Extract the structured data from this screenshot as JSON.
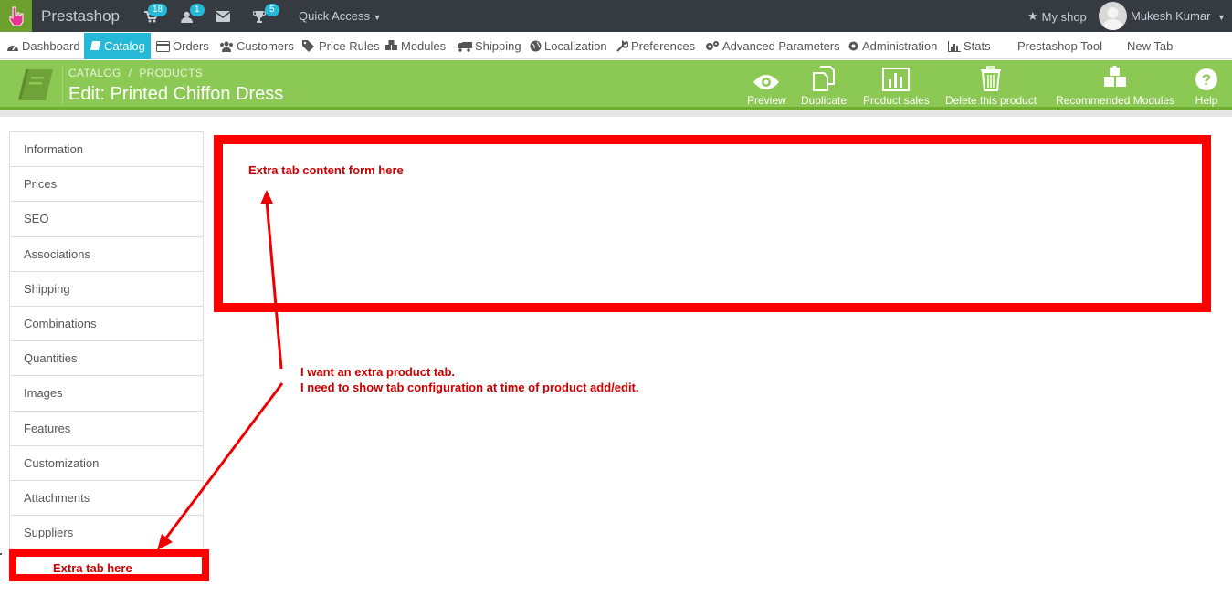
{
  "topbar": {
    "shop_name": "Prestashop",
    "cart_badge": "18",
    "customers_badge": "1",
    "trophy_badge": "5",
    "quick_access": "Quick Access",
    "my_shop": "My shop",
    "user_name": "Mukesh Kumar"
  },
  "nav": {
    "items": [
      {
        "label": "Dashboard",
        "icon": "dashboard-icon"
      },
      {
        "label": "Catalog",
        "icon": "book-icon",
        "active": true
      },
      {
        "label": "Orders",
        "icon": "credit-card-icon"
      },
      {
        "label": "Customers",
        "icon": "group-icon"
      },
      {
        "label": "Price Rules",
        "icon": "tags-icon"
      },
      {
        "label": "Modules",
        "icon": "puzzle-icon"
      },
      {
        "label": "Shipping",
        "icon": "truck-icon"
      },
      {
        "label": "Localization",
        "icon": "globe-icon"
      },
      {
        "label": "Preferences",
        "icon": "wrench-icon"
      },
      {
        "label": "Advanced Parameters",
        "icon": "cogs-icon"
      },
      {
        "label": "Administration",
        "icon": "cog-icon"
      },
      {
        "label": "Stats",
        "icon": "bar-chart-icon"
      },
      {
        "label": "Prestashop Tool",
        "icon": ""
      },
      {
        "label": "New Tab",
        "icon": ""
      }
    ]
  },
  "header": {
    "breadcrumb": [
      "CATALOG",
      "PRODUCTS"
    ],
    "title": "Edit: Printed Chiffon Dress",
    "toolbar": [
      {
        "label": "Preview",
        "icon": "eye-icon"
      },
      {
        "label": "Duplicate",
        "icon": "copy-icon"
      },
      {
        "label": "Product sales",
        "icon": "bar-chart-icon"
      },
      {
        "label": "Delete this product",
        "icon": "trash-icon"
      },
      {
        "label": "Recommended Modules",
        "icon": "puzzle-icon"
      },
      {
        "label": "Help",
        "icon": "question-icon"
      }
    ]
  },
  "tabs": [
    "Information",
    "Prices",
    "SEO",
    "Associations",
    "Shipping",
    "Combinations",
    "Quantities",
    "Images",
    "Features",
    "Customization",
    "Attachments",
    "Suppliers"
  ],
  "annotations": {
    "extra_tab": "Extra tab here",
    "content_box": "Extra tab content form here",
    "note_line1": "I want an extra product tab.",
    "note_line2": "I need to show tab configuration at time of product add/edit."
  },
  "colors": {
    "topbar": "#363a41",
    "accent": "#25b9d7",
    "header_green": "#8bc954",
    "annotation_red": "#ff0000"
  }
}
